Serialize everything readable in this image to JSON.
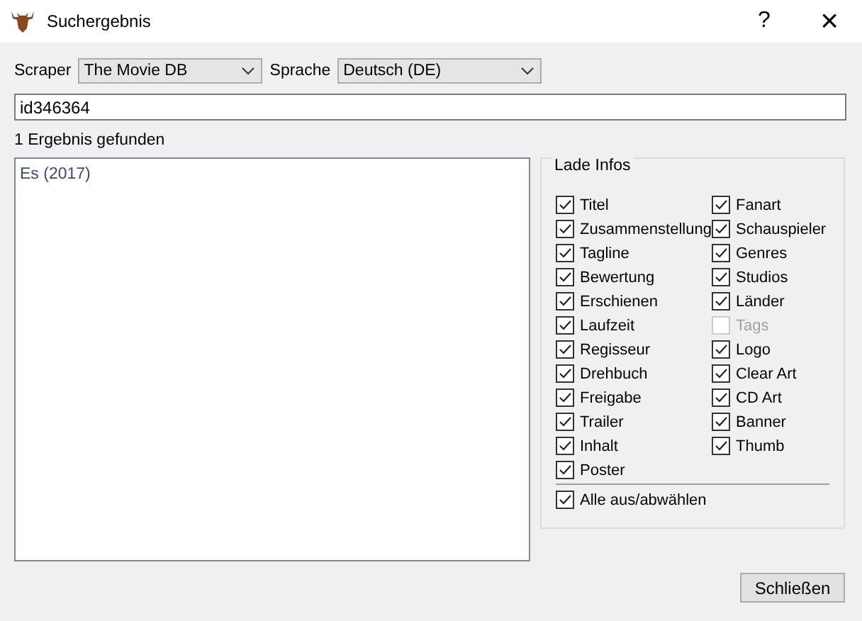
{
  "window": {
    "title": "Suchergebnis",
    "help": "?",
    "close": "×"
  },
  "scraper": {
    "label": "Scraper",
    "value": "The Movie DB"
  },
  "language": {
    "label": "Sprache",
    "value": "Deutsch (DE)"
  },
  "search": {
    "value": "id346364"
  },
  "result_count": "1 Ergebnis gefunden",
  "results": [
    {
      "label": "Es (2017)",
      "selected": false
    }
  ],
  "load_info": {
    "title": "Lade Infos",
    "left": [
      {
        "label": "Titel",
        "checked": true,
        "disabled": false
      },
      {
        "label": "Zusammenstellung",
        "checked": true,
        "disabled": false
      },
      {
        "label": "Tagline",
        "checked": true,
        "disabled": false
      },
      {
        "label": "Bewertung",
        "checked": true,
        "disabled": false
      },
      {
        "label": "Erschienen",
        "checked": true,
        "disabled": false
      },
      {
        "label": "Laufzeit",
        "checked": true,
        "disabled": false
      },
      {
        "label": "Regisseur",
        "checked": true,
        "disabled": false
      },
      {
        "label": "Drehbuch",
        "checked": true,
        "disabled": false
      },
      {
        "label": "Freigabe",
        "checked": true,
        "disabled": false
      },
      {
        "label": "Trailer",
        "checked": true,
        "disabled": false
      },
      {
        "label": "Inhalt",
        "checked": true,
        "disabled": false
      },
      {
        "label": "Poster",
        "checked": true,
        "disabled": false
      }
    ],
    "right": [
      {
        "label": "Fanart",
        "checked": true,
        "disabled": false
      },
      {
        "label": "Schauspieler",
        "checked": true,
        "disabled": false
      },
      {
        "label": "Genres",
        "checked": true,
        "disabled": false
      },
      {
        "label": "Studios",
        "checked": true,
        "disabled": false
      },
      {
        "label": "Länder",
        "checked": true,
        "disabled": false
      },
      {
        "label": "Tags",
        "checked": false,
        "disabled": true
      },
      {
        "label": "Logo",
        "checked": true,
        "disabled": false
      },
      {
        "label": "Clear Art",
        "checked": true,
        "disabled": false
      },
      {
        "label": "CD Art",
        "checked": true,
        "disabled": false
      },
      {
        "label": "Banner",
        "checked": true,
        "disabled": false
      },
      {
        "label": "Thumb",
        "checked": true,
        "disabled": false
      }
    ],
    "select_all": {
      "label": "Alle aus/abwählen",
      "checked": true,
      "disabled": false
    }
  },
  "buttons": [
    "Schließen"
  ]
}
